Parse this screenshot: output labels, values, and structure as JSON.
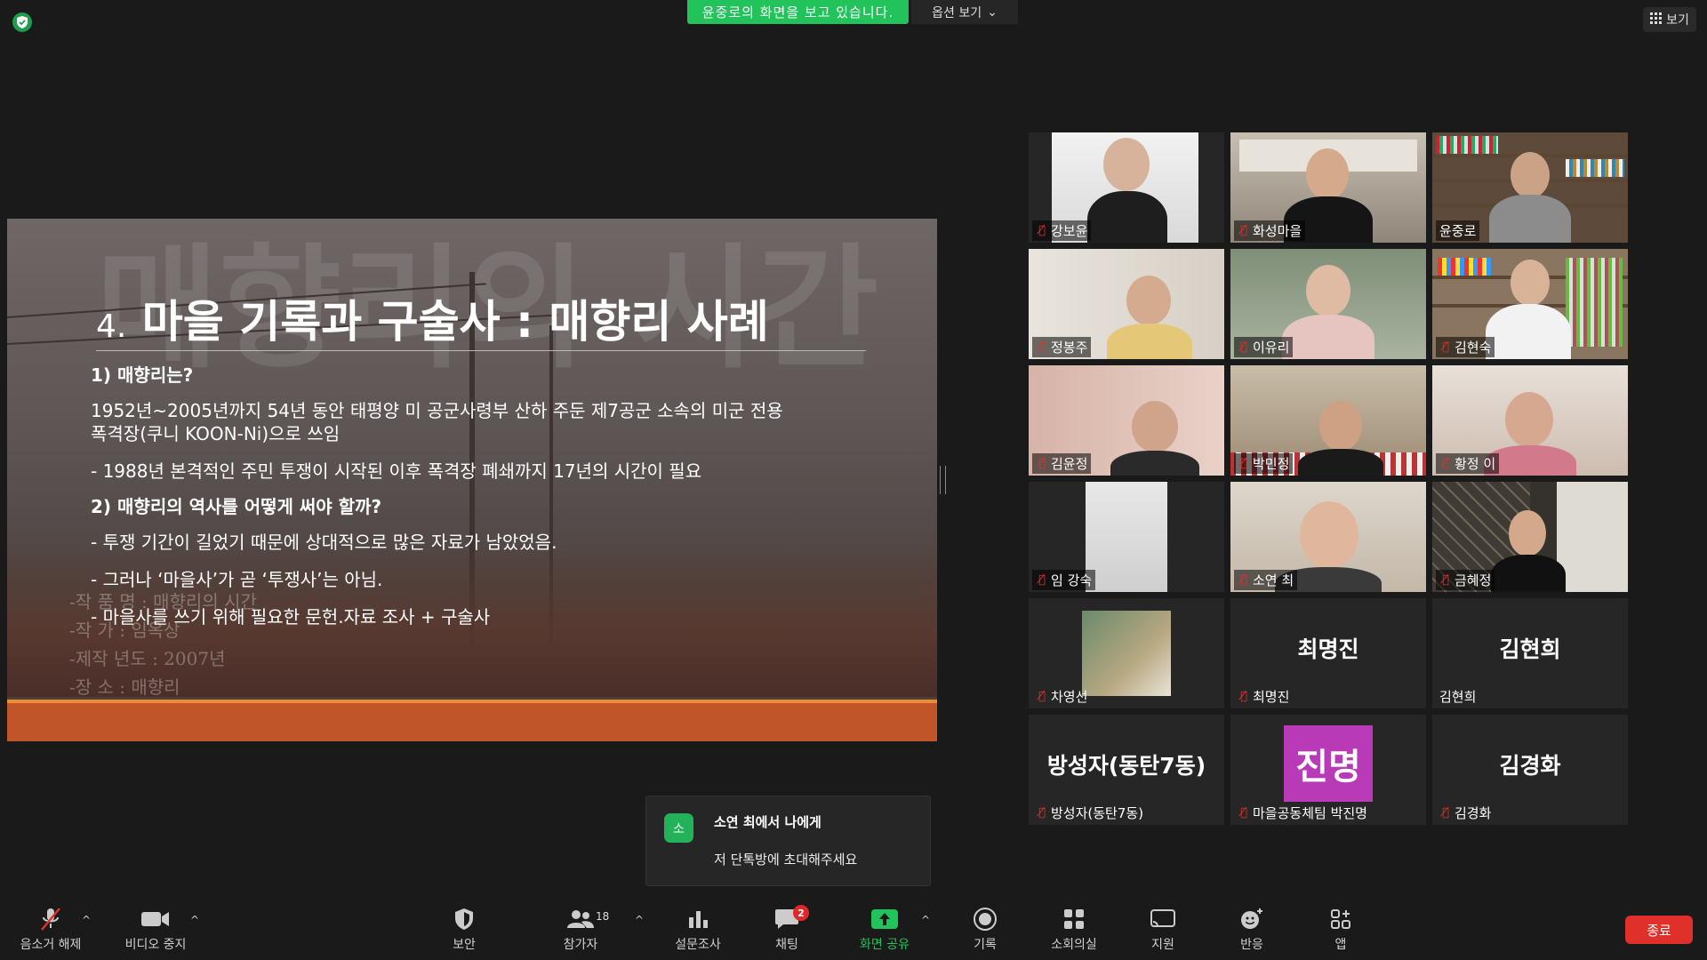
{
  "top": {
    "viewing_banner": "윤중로의 화면을 보고 있습니다.",
    "view_options": "옵션 보기",
    "view_button": "보기"
  },
  "slide": {
    "title_num": "4.",
    "title_text": "마을 기록과 구술사 : 매향리 사례",
    "lines": [
      "1) 매향리는?",
      "1952년~2005년까지 54년 동안 태평양 미 공군사령부 산하 주둔 제7공군 소속의 미군 전용",
      "폭격장(쿠니 KOON-Ni)으로 쓰임",
      "- 1988년 본격적인 주민 투쟁이 시작된 이후 폭격장 폐쇄까지 17년의 시간이 필요",
      "2) 매향리의 역사를 어떻게 써야 할까?",
      "- 투쟁 기간이 길었기 때문에 상대적으로 많은 자료가 남았었음.",
      "- 그러나 ‘마을사’가 곧 ‘투쟁사’는 아님.",
      "- 마을사를 쓰기 위해 필요한 문헌.자료 조사 + 구술사"
    ],
    "bg_text": "매향리의 시간",
    "credits": [
      "-작 품 명 : 매향리의 시간",
      "-작      가 : 임옥상",
      "-제작 년도 : 2007년",
      "-장      소 : 매향리"
    ]
  },
  "participants": [
    {
      "name": "강보윤",
      "muted": true
    },
    {
      "name": "화성마을",
      "muted": true
    },
    {
      "name": "윤중로",
      "muted": false,
      "active": true
    },
    {
      "name": "정봉주",
      "muted": true
    },
    {
      "name": "이유리",
      "muted": true
    },
    {
      "name": "김현숙",
      "muted": true
    },
    {
      "name": "김윤정",
      "muted": true
    },
    {
      "name": "박민정",
      "muted": true
    },
    {
      "name": "황정 이",
      "muted": true
    },
    {
      "name": "임 강숙",
      "muted": true
    },
    {
      "name": "소연 최",
      "muted": true
    },
    {
      "name": "금혜정",
      "muted": true
    },
    {
      "name": "차영선",
      "muted": true
    },
    {
      "name": "최명진",
      "muted": true,
      "big": "최명진"
    },
    {
      "name": "김현희",
      "muted": false,
      "big": "김현희"
    },
    {
      "name": "방성자(동탄7동)",
      "muted": true,
      "big": "방성자(동탄7동)"
    },
    {
      "name": "마을공동체팀 박진명",
      "muted": true,
      "avatar": "진명"
    },
    {
      "name": "김경화",
      "muted": true,
      "big": "김경화"
    }
  ],
  "toast": {
    "icon_letter": "소",
    "from": "소연 최에서 나에게",
    "message": "저 단톡방에 초대해주세요"
  },
  "toolbar": {
    "unmute": "음소거 해제",
    "stop_video": "비디오 중지",
    "security": "보안",
    "participants": "참가자",
    "participants_count": "18",
    "polls": "설문조사",
    "chat": "채팅",
    "chat_badge": "2",
    "share": "화면 공유",
    "record": "기록",
    "breakout": "소회의실",
    "support": "지원",
    "reactions": "반응",
    "apps": "앱",
    "end": "종료"
  }
}
